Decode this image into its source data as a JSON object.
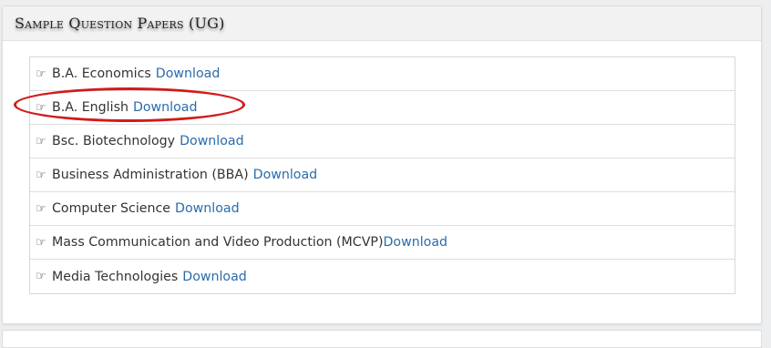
{
  "panel": {
    "title": "Sample Question Papers (UG)"
  },
  "items": [
    {
      "label": "B.A. Economics",
      "link": "Download",
      "gap": true
    },
    {
      "label": "B.A. English",
      "link": "Download",
      "gap": true
    },
    {
      "label": "Bsc. Biotechnology",
      "link": "Download",
      "gap": true
    },
    {
      "label": "Business Administration (BBA)",
      "link": "Download",
      "gap": true
    },
    {
      "label": "Computer Science",
      "link": "Download",
      "gap": true
    },
    {
      "label": "Mass Communication and Video Production (MCVP)",
      "link": "Download",
      "gap": false
    },
    {
      "label": "Media Technologies",
      "link": "Download",
      "gap": true
    }
  ],
  "icons": {
    "item_icon": "hand-pointing-right-icon"
  },
  "annotation": {
    "highlight_color": "#d21a1a",
    "highlighted_item": "B.A. English"
  },
  "colors": {
    "link": "#2a6cab",
    "text": "#333333"
  }
}
